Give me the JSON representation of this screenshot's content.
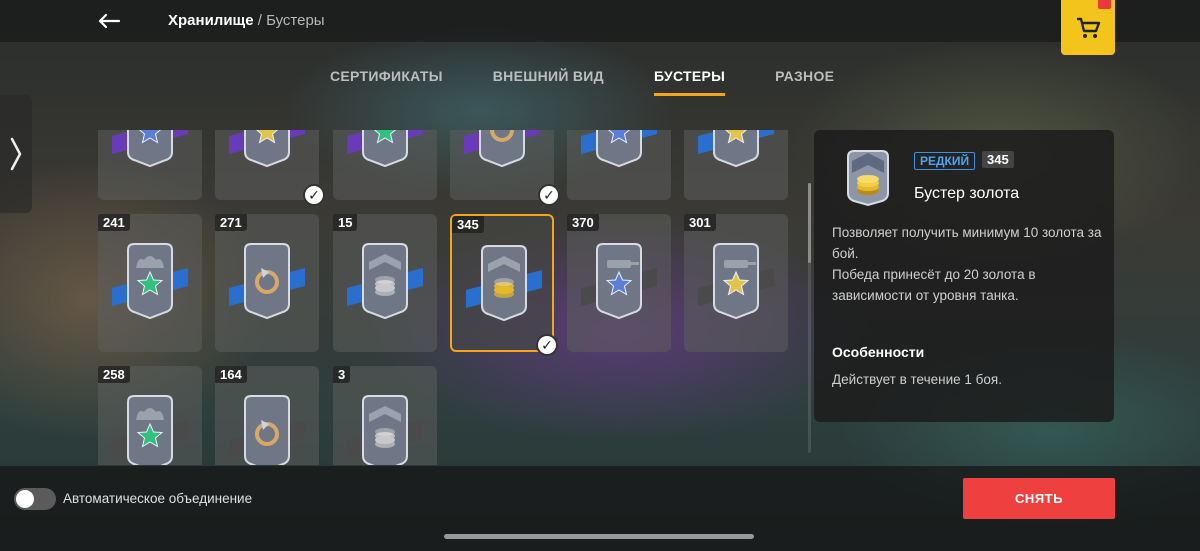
{
  "header": {
    "title": "Хранилище",
    "separator": "/",
    "subtitle": "Бустеры",
    "back_icon": "arrow-left-icon",
    "shop_icon": "cart-icon",
    "shop_badge_icon": "gift-icon"
  },
  "tabs": [
    {
      "label": "СЕРТИФИКАТЫ",
      "active": false
    },
    {
      "label": "ВНЕШНИЙ ВИД",
      "active": false
    },
    {
      "label": "БУСТЕРЫ",
      "active": true
    },
    {
      "label": "РАЗНОЕ",
      "active": false
    }
  ],
  "side_handle_icon": "chevron-right-icon",
  "items": [
    {
      "count": "",
      "symbol": "star",
      "star_color": "#5a7fd6",
      "ribbon": "#6a3bb8",
      "checked": false,
      "row": 0,
      "col": 0
    },
    {
      "count": "",
      "symbol": "star",
      "star_color": "#e2c44a",
      "ribbon": "#6a3bb8",
      "checked": true,
      "row": 0,
      "col": 1
    },
    {
      "count": "",
      "symbol": "star",
      "star_color": "#2fc27a",
      "ribbon": "#6a3bb8",
      "checked": false,
      "row": 0,
      "col": 2
    },
    {
      "count": "",
      "symbol": "refresh",
      "star_color": "#d8a868",
      "ribbon": "#6a3bb8",
      "checked": true,
      "row": 0,
      "col": 3
    },
    {
      "count": "",
      "symbol": "star",
      "star_color": "#5a7fd6",
      "ribbon": "#2a6fd0",
      "checked": false,
      "row": 0,
      "col": 4
    },
    {
      "count": "",
      "symbol": "star",
      "star_color": "#e2c44a",
      "ribbon": "#2a6fd0",
      "checked": false,
      "row": 0,
      "col": 5
    },
    {
      "count": "241",
      "symbol": "crew-star",
      "star_color": "#2fc27a",
      "ribbon": "#2a6fd0",
      "checked": false,
      "row": 1,
      "col": 0
    },
    {
      "count": "271",
      "symbol": "refresh",
      "star_color": "#d8a868",
      "ribbon": "#2a6fd0",
      "checked": false,
      "row": 1,
      "col": 1
    },
    {
      "count": "15",
      "symbol": "coins-silver",
      "star_color": "#c8c8c8",
      "ribbon": "#2a6fd0",
      "checked": false,
      "row": 1,
      "col": 2
    },
    {
      "count": "345",
      "symbol": "coins-gold",
      "star_color": "#e6b92a",
      "ribbon": "#2a6fd0",
      "checked": true,
      "selected": true,
      "row": 1,
      "col": 3
    },
    {
      "count": "370",
      "symbol": "tank-star",
      "star_color": "#5a7fd6",
      "ribbon": "#4a4a4a",
      "checked": false,
      "row": 1,
      "col": 4
    },
    {
      "count": "301",
      "symbol": "tank-star",
      "star_color": "#e2c44a",
      "ribbon": "#4a4a4a",
      "checked": false,
      "row": 1,
      "col": 5
    },
    {
      "count": "258",
      "symbol": "crew-star",
      "star_color": "#2fc27a",
      "ribbon": "#4a4a4a",
      "checked": false,
      "row": 2,
      "col": 0
    },
    {
      "count": "164",
      "symbol": "refresh",
      "star_color": "#d8a868",
      "ribbon": "#4a4a4a",
      "checked": false,
      "row": 2,
      "col": 1
    },
    {
      "count": "3",
      "symbol": "coins-silver",
      "star_color": "#c8c8c8",
      "ribbon": "#4a4a4a",
      "checked": false,
      "row": 2,
      "col": 2
    }
  ],
  "detail": {
    "rarity": "РЕДКИЙ",
    "count": "345",
    "name": "Бустер золота",
    "description_lines": [
      "Позволяет получить минимум 10 золота за бой.",
      "Победа принесёт до 20 золота в зависимости от уровня танка."
    ],
    "features_title": "Особенности",
    "features_text": "Действует в течение 1 боя.",
    "icon": "gold-coins-booster-icon"
  },
  "bottom": {
    "toggle_label": "Автоматическое объединение",
    "toggle_on": false,
    "remove_button": "СНЯТЬ"
  },
  "colors": {
    "accent": "#f3a51b",
    "shop": "#f3c41b",
    "remove": "#ef4040",
    "rarity": "#4fa3f0"
  }
}
